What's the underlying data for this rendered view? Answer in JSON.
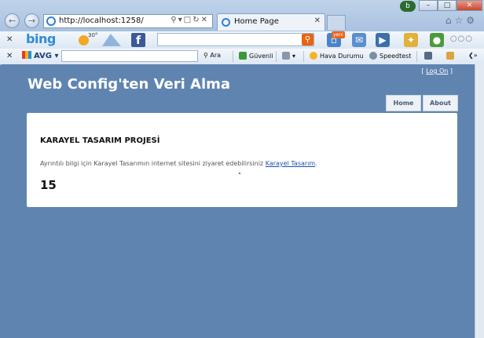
{
  "browser": {
    "address_url": "http://localhost:1258/",
    "tab_title": "Home Page",
    "colors": {
      "chrome": "#bfd3ea",
      "page_bg": "#5f84b0"
    }
  },
  "bing_bar": {
    "logo": "bing",
    "weather_temp": "30°",
    "facebook_letter": "f",
    "new_badge": "yeni"
  },
  "avg_bar": {
    "logo": "AVG",
    "search_label": "Ara",
    "safe_label": "Güvenli",
    "weather_label": "Hava Durumu",
    "speedtest_label": "Speedtest"
  },
  "site": {
    "title": "Web Config'ten Veri Alma",
    "login_prefix": "[ ",
    "login_link": "Log On",
    "login_suffix": " ]",
    "menu": [
      {
        "label": "Home"
      },
      {
        "label": "About"
      }
    ]
  },
  "main": {
    "heading": "KARAYEL TASARIM PROJESİ",
    "description": "Ayrıntılı bilgi için Karayel Tasarımın internet sitesini ziyaret edebilirsiniz",
    "link_text": "Karayel Tasarım",
    "link_suffix": ".",
    "value": "15"
  }
}
